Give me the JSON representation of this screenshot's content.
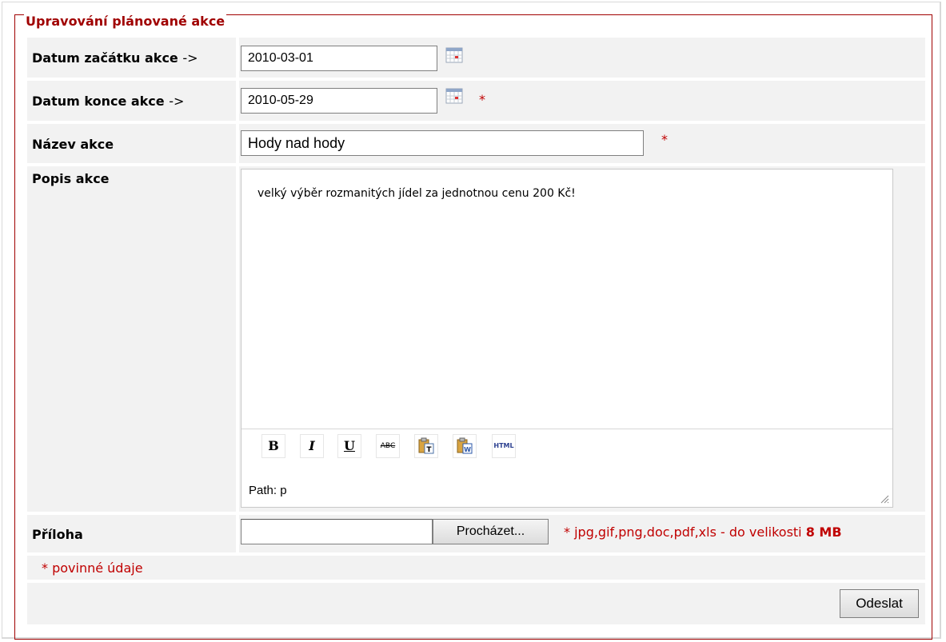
{
  "form": {
    "legend": "Upravování plánované akce",
    "fields": {
      "start_date": {
        "label": "Datum začátku akce",
        "arrow": "->",
        "value": "2010-03-01"
      },
      "end_date": {
        "label": "Datum konce akce",
        "arrow": "->",
        "value": "2010-05-29",
        "required_mark": "*"
      },
      "name": {
        "label": "Název akce",
        "value": "Hody nad hody",
        "required_mark": "*"
      },
      "description": {
        "label": "Popis akce",
        "value": "velký výběr rozmanitých jídel za jednotnou cenu 200 Kč!"
      },
      "attachment": {
        "label": "Příloha",
        "browse_label": "Procházet...",
        "hint_prefix": "* jpg,gif,png,doc,pdf,xls - do velikosti",
        "hint_size": "8 MB"
      }
    },
    "editor": {
      "toolbar": [
        {
          "name": "bold",
          "label": "B"
        },
        {
          "name": "italic",
          "label": "I"
        },
        {
          "name": "underline",
          "label": "U"
        },
        {
          "name": "strikethrough",
          "label": "ABC"
        },
        {
          "name": "paste-text",
          "label": "T"
        },
        {
          "name": "paste-word",
          "label": "W"
        },
        {
          "name": "html",
          "label": "HTML"
        }
      ],
      "path": "Path: p"
    },
    "required_note": "* povinné údaje",
    "submit_label": "Odeslat"
  },
  "colors": {
    "accent": "#a00000",
    "required": "#c00000",
    "row_bg": "#f2f2f2"
  }
}
